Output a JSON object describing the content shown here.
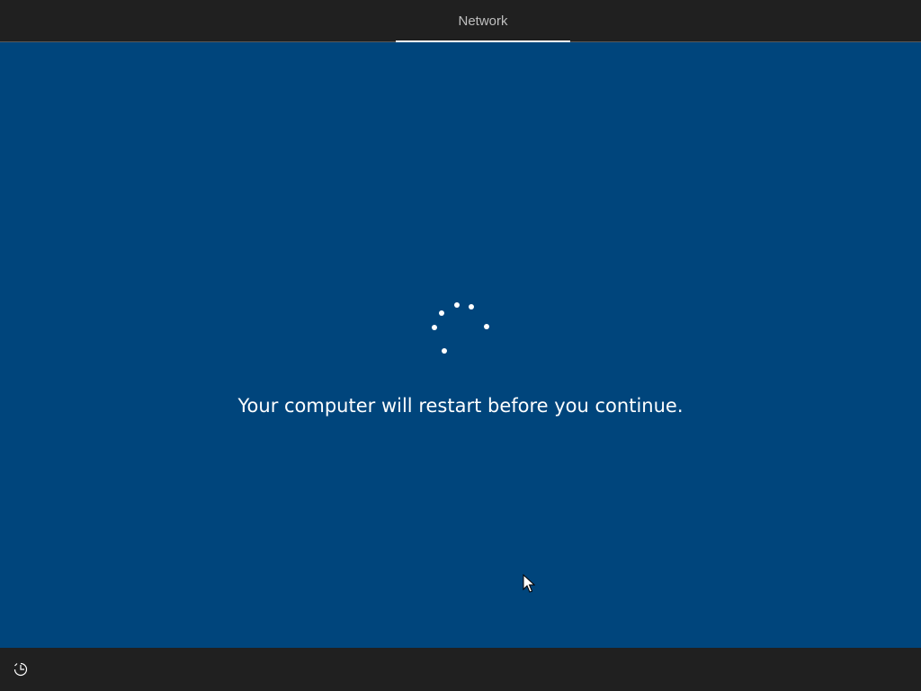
{
  "header": {
    "tabs": [
      {
        "label": "Network",
        "active": true
      }
    ]
  },
  "main": {
    "status_message": "Your computer will restart before you continue.",
    "spinner": {
      "icon": "loading-spinner-icon",
      "color": "#ffffff"
    }
  },
  "footer": {
    "ease_of_access_icon": "accessibility-icon"
  },
  "colors": {
    "background": "#00457c",
    "bar_background": "#202020",
    "tab_text": "#bfbfbf",
    "text": "#ffffff"
  }
}
